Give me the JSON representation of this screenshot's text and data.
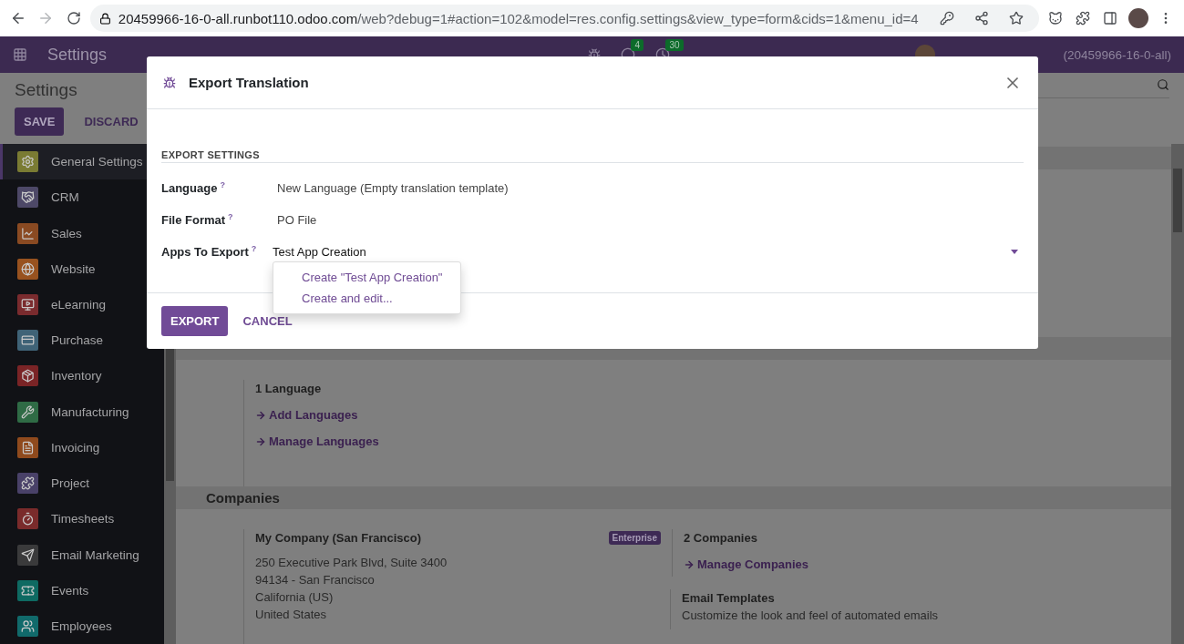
{
  "browser": {
    "forward_disabled": true,
    "url_host": "20459966-16-0-all.runbot110.odoo.com",
    "url_path": "/web?debug=1#action=102&model=res.config.settings&view_type=form&cids=1&menu_id=4"
  },
  "navbar": {
    "app": "Settings",
    "messages_badge": "4",
    "activities_badge": "30",
    "user": "(20459966-16-0-all)"
  },
  "control_panel": {
    "breadcrumb": "Settings",
    "buttons": [
      {
        "label": "SAVE",
        "kind": "primary"
      },
      {
        "label": "DISCARD",
        "kind": "link"
      }
    ]
  },
  "sidebar": {
    "items": [
      {
        "label": "General Settings",
        "kind": "gear",
        "color": "#7a7b33",
        "selected": true
      },
      {
        "label": "CRM",
        "kind": "handshake",
        "color": "#4d4867",
        "selected": false
      },
      {
        "label": "Sales",
        "kind": "chart",
        "color": "#8a4a22",
        "selected": false
      },
      {
        "label": "Website",
        "kind": "globe",
        "color": "#98521f",
        "selected": false
      },
      {
        "label": "eLearning",
        "kind": "screen",
        "color": "#7a2b2e",
        "selected": false
      },
      {
        "label": "Purchase",
        "kind": "card",
        "color": "#3f6377",
        "selected": false
      },
      {
        "label": "Inventory",
        "kind": "box",
        "color": "#7a2426",
        "selected": false
      },
      {
        "label": "Manufacturing",
        "kind": "wrench",
        "color": "#2f6b45",
        "selected": false
      },
      {
        "label": "Invoicing",
        "kind": "invoice",
        "color": "#8f4a1d",
        "selected": false
      },
      {
        "label": "Project",
        "kind": "puzzle",
        "color": "#494168",
        "selected": false
      },
      {
        "label": "Timesheets",
        "kind": "timer",
        "color": "#7a2b2b",
        "selected": false
      },
      {
        "label": "Email Marketing",
        "kind": "send",
        "color": "#3a3a3b",
        "selected": false
      },
      {
        "label": "Events",
        "kind": "ticket",
        "color": "#0e6a62",
        "selected": false
      },
      {
        "label": "Employees",
        "kind": "users",
        "color": "#116a6b",
        "selected": false
      }
    ]
  },
  "languages": {
    "count": "1 Language",
    "links": [
      "Add Languages",
      "Manage Languages"
    ]
  },
  "companies": {
    "title": "Companies",
    "company_name": "My Company (San Francisco)",
    "badge": "Enterprise",
    "address": [
      "250 Executive Park Blvd, Suite 3400",
      "94134 - San Francisco",
      "California (US)",
      "United States"
    ],
    "count": "2 Companies",
    "link": "Manage Companies",
    "templates_title": "Email Templates",
    "templates_text": "Customize the look and feel of automated emails"
  },
  "dialog": {
    "title": "Export Translation",
    "section": "EXPORT SETTINGS",
    "fields": [
      {
        "label": "Language",
        "help": "?",
        "kind": "text",
        "value": "New Language (Empty translation template)"
      },
      {
        "label": "File Format",
        "help": "?",
        "kind": "text",
        "value": "PO File"
      },
      {
        "label": "Apps To Export",
        "help": "?",
        "kind": "input",
        "value": "Test App Creation"
      }
    ],
    "dropdown": [
      "Create \"Test App Creation\"",
      "Create and edit..."
    ],
    "buttons": [
      {
        "label": "EXPORT",
        "kind": "primary"
      },
      {
        "label": "CANCEL",
        "kind": "link"
      }
    ]
  }
}
